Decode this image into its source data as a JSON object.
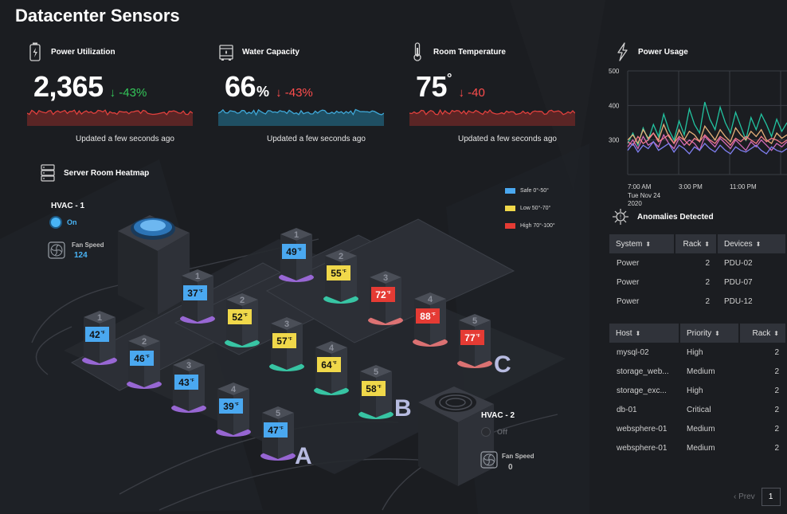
{
  "page": {
    "title": "Datacenter Sensors"
  },
  "colors": {
    "background": "#1b1d21",
    "safe": "#4aa8f0",
    "low": "#f0d84a",
    "high": "#e53b34",
    "positive": "#34c759",
    "negative": "#ff4d4d",
    "hvac_on": "#49b4f5"
  },
  "kpis": [
    {
      "label": "Power Utilization",
      "icon": "battery-icon",
      "value": "2,365",
      "unit": "",
      "sup": "",
      "delta": "↓ -43%",
      "delta_color": "#34c759",
      "spark_fill": "#5a2525",
      "spark_line": "#e0403d",
      "updated": "Updated a few seconds ago"
    },
    {
      "label": "Water Capacity",
      "icon": "water-tank-icon",
      "value": "66",
      "unit": "%",
      "sup": "",
      "delta": "↓ -43%",
      "delta_color": "#ff4d4d",
      "spark_fill": "#1f4f63",
      "spark_line": "#3fa8d8",
      "updated": "Updated a few seconds ago"
    },
    {
      "label": "Room Temperature",
      "icon": "thermometer-icon",
      "value": "75",
      "unit": "",
      "sup": "°",
      "delta": "↓ -40",
      "delta_color": "#ff4d4d",
      "spark_fill": "#5a2525",
      "spark_line": "#e0403d",
      "updated": "Updated a few seconds ago"
    }
  ],
  "power_usage": {
    "label": "Power Usage",
    "icon": "lightning-icon"
  },
  "chart_data": {
    "type": "line",
    "ylim": [
      200,
      500
    ],
    "y_ticks": [
      "500",
      "400",
      "300"
    ],
    "x_ticks": [
      "7:00 AM",
      "3:00 PM",
      "11:00 PM"
    ],
    "x_subtitle": [
      "Tue Nov 24",
      "2020"
    ],
    "grid": true,
    "series": [
      {
        "color": "#22c3a0",
        "values": [
          290,
          320,
          285,
          335,
          300,
          345,
          310,
          375,
          330,
          300,
          355,
          315,
          390,
          345,
          320,
          410,
          360,
          330,
          395,
          350,
          320,
          380,
          340,
          300,
          365,
          330,
          375,
          345,
          310,
          360,
          325,
          350
        ]
      },
      {
        "color": "#e6b17a",
        "values": [
          300,
          315,
          290,
          330,
          305,
          320,
          300,
          345,
          310,
          290,
          330,
          300,
          325,
          315,
          295,
          340,
          320,
          300,
          330,
          310,
          295,
          335,
          315,
          300,
          325,
          310,
          330,
          300,
          290,
          320,
          305,
          315
        ]
      },
      {
        "color": "#d06ab8",
        "values": [
          280,
          300,
          275,
          310,
          285,
          295,
          280,
          315,
          290,
          275,
          305,
          285,
          300,
          290,
          270,
          310,
          295,
          280,
          305,
          290,
          275,
          300,
          285,
          270,
          295,
          280,
          300,
          285,
          270,
          290,
          280,
          295
        ]
      },
      {
        "color": "#f27a8a",
        "values": [
          295,
          285,
          310,
          290,
          300,
          320,
          295,
          305,
          315,
          290,
          310,
          300,
          285,
          305,
          295,
          315,
          300,
          290,
          310,
          300,
          285,
          305,
          295,
          310,
          300,
          290,
          310,
          295,
          305,
          300,
          290,
          300
        ]
      },
      {
        "color": "#7f7ff0",
        "values": [
          270,
          290,
          265,
          285,
          275,
          295,
          270,
          280,
          290,
          265,
          285,
          275,
          260,
          280,
          270,
          290,
          275,
          265,
          285,
          270,
          260,
          280,
          270,
          265,
          275,
          285,
          270,
          260,
          280,
          270,
          265,
          275
        ]
      }
    ]
  },
  "anomalies": {
    "label": "Anomalies Detected",
    "icon": "virus-alert-icon",
    "table1": {
      "headers": [
        "System",
        "Rack",
        "Devices"
      ],
      "rows": [
        [
          "Power",
          "2",
          "PDU-02"
        ],
        [
          "Power",
          "2",
          "PDU-07"
        ],
        [
          "Power",
          "2",
          "PDU-12"
        ]
      ]
    },
    "table2": {
      "headers": [
        "Host",
        "Priority",
        "Rack"
      ],
      "rows": [
        [
          "mysql-02",
          "High",
          "2"
        ],
        [
          "storage_web...",
          "Medium",
          "2"
        ],
        [
          "storage_exc...",
          "High",
          "2"
        ],
        [
          "db-01",
          "Critical",
          "2"
        ],
        [
          "websphere-01",
          "Medium",
          "2"
        ],
        [
          "websphere-01",
          "Medium",
          "2"
        ]
      ]
    },
    "pager": {
      "prev": "Prev",
      "page": "1"
    }
  },
  "heatmap": {
    "label": "Server Room Heatmap",
    "icon": "server-icon",
    "legend": [
      {
        "label": "Safe 0°-50°",
        "color": "#4aa8f0"
      },
      {
        "label": "Low 50°-70°",
        "color": "#f0d84a"
      },
      {
        "label": "High 70°-100°",
        "color": "#e53b34"
      }
    ],
    "hvac1": {
      "title": "HVAC - 1",
      "status": "On",
      "fan_label": "Fan Speed",
      "fan_value": "124"
    },
    "hvac2": {
      "title": "HVAC - 2",
      "status": "Off",
      "fan_label": "Fan Speed",
      "fan_value": "0"
    },
    "rows": [
      {
        "label": "A",
        "racks": [
          {
            "num": "1",
            "temp": "42",
            "level": "safe"
          },
          {
            "num": "2",
            "temp": "46",
            "level": "safe"
          },
          {
            "num": "3",
            "temp": "43",
            "level": "safe"
          },
          {
            "num": "4",
            "temp": "39",
            "level": "safe"
          },
          {
            "num": "5",
            "temp": "47",
            "level": "safe"
          }
        ]
      },
      {
        "label": "B",
        "racks": [
          {
            "num": "1",
            "temp": "37",
            "level": "safe"
          },
          {
            "num": "2",
            "temp": "52",
            "level": "low"
          },
          {
            "num": "3",
            "temp": "57",
            "level": "low"
          },
          {
            "num": "4",
            "temp": "64",
            "level": "low"
          },
          {
            "num": "5",
            "temp": "58",
            "level": "low"
          }
        ]
      },
      {
        "label": "C",
        "racks": [
          {
            "num": "1",
            "temp": "49",
            "level": "safe"
          },
          {
            "num": "2",
            "temp": "55",
            "level": "low"
          },
          {
            "num": "3",
            "temp": "72",
            "level": "high"
          },
          {
            "num": "4",
            "temp": "88",
            "level": "high"
          },
          {
            "num": "5",
            "temp": "77",
            "level": "high"
          }
        ]
      }
    ]
  }
}
